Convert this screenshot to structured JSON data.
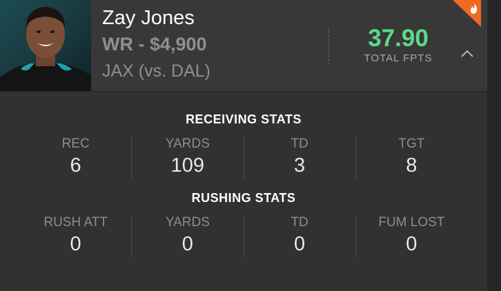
{
  "player": {
    "name": "Zay Jones",
    "position_salary": "WR - $4,900",
    "matchup": "JAX (vs. DAL)",
    "total_fpts": "37.90",
    "total_fpts_label": "TOTAL FPTS"
  },
  "colors": {
    "fpts": "#5bd88b",
    "hot_badge": "#ef6a23"
  },
  "icons": {
    "expand": "chevron-up-icon",
    "hot": "fire-icon"
  },
  "receiving": {
    "title": "RECEIVING STATS",
    "stats": [
      {
        "label": "REC",
        "value": "6"
      },
      {
        "label": "YARDS",
        "value": "109"
      },
      {
        "label": "TD",
        "value": "3"
      },
      {
        "label": "TGT",
        "value": "8"
      }
    ]
  },
  "rushing": {
    "title": "RUSHING STATS",
    "stats": [
      {
        "label": "RUSH ATT",
        "value": "0"
      },
      {
        "label": "YARDS",
        "value": "0"
      },
      {
        "label": "TD",
        "value": "0"
      },
      {
        "label": "FUM LOST",
        "value": "0"
      }
    ]
  }
}
